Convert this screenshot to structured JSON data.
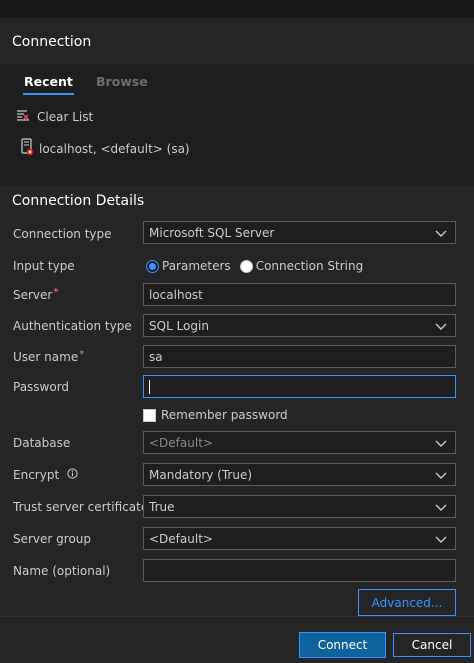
{
  "connection_panel": {
    "title": "Connection",
    "tabs": [
      {
        "label": "Recent",
        "active": true
      },
      {
        "label": "Browse",
        "active": false
      }
    ],
    "clear_list_label": "Clear List",
    "recent_items": [
      {
        "label": "localhost, <default> (sa)",
        "icon": "server-icon"
      }
    ]
  },
  "details": {
    "title": "Connection Details",
    "connection_type": {
      "label": "Connection type",
      "value": "Microsoft SQL Server"
    },
    "input_type": {
      "label": "Input type",
      "options": [
        {
          "label": "Parameters",
          "selected": true
        },
        {
          "label": "Connection String",
          "selected": false
        }
      ]
    },
    "server": {
      "label": "Server",
      "required_mark": "*",
      "value": "localhost"
    },
    "authentication_type": {
      "label": "Authentication type",
      "value": "SQL Login"
    },
    "user_name": {
      "label": "User name",
      "required_mark": "*",
      "value": "sa"
    },
    "password": {
      "label": "Password",
      "value": ""
    },
    "remember_password": {
      "label": "Remember password",
      "checked": false
    },
    "database": {
      "label": "Database",
      "value": "<Default>"
    },
    "encrypt": {
      "label": "Encrypt",
      "value": "Mandatory (True)",
      "info_icon": "info-icon"
    },
    "trust_server_certificate": {
      "label": "Trust server certificate",
      "value": "True",
      "info_icon": "info-icon"
    },
    "server_group": {
      "label": "Server group",
      "value": "<Default>"
    },
    "name_optional": {
      "label": "Name (optional)",
      "value": ""
    },
    "advanced_label": "Advanced..."
  },
  "footer": {
    "connect_label": "Connect",
    "cancel_label": "Cancel"
  },
  "colors": {
    "accent": "#3794ff",
    "primary_button": "#0e639c",
    "background": "#1e1e1e",
    "panel": "#252526",
    "required": "#f48771"
  }
}
